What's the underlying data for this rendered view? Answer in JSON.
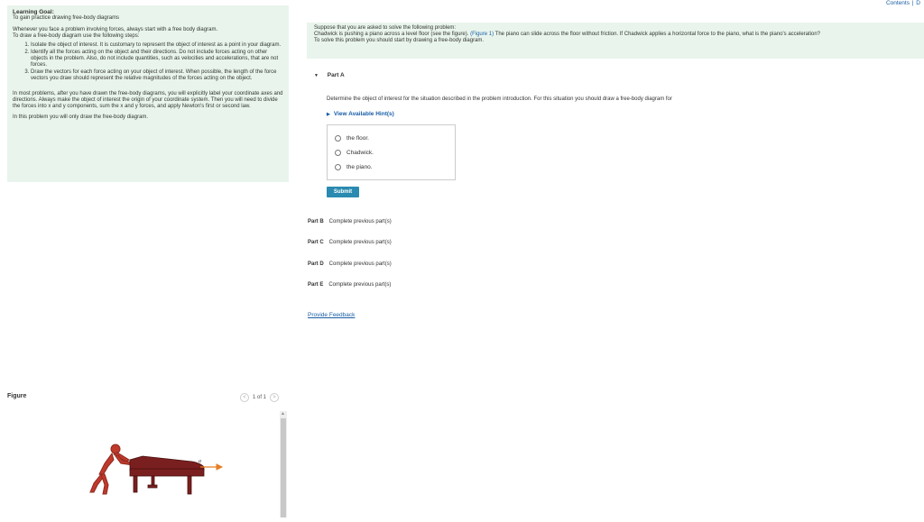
{
  "header": {
    "links": [
      "Contents",
      "|",
      "D"
    ]
  },
  "goal": {
    "title": "Learning Goal:",
    "subtitle": "To gain practice drawing free-body diagrams",
    "intro1": "Whenever you face a problem involving forces, always start with a free body diagram.",
    "intro2": "To draw a free-body diagram use the following steps:",
    "steps": [
      "Isolate the object of interest. It is customary to represent the object of interest as a point in your diagram.",
      "Identify all the forces acting on the object and their directions. Do not include forces acting on other objects in the problem. Also, do not include quantities, such as velocities and accelerations, that are not forces.",
      "Draw the vectors for each force acting on your object of interest. When possible, the length of the force vectors you draw should represent the relative magnitudes of the forces acting on the object."
    ],
    "para1": "In most problems, after you have drawn the free-body diagrams, you will explicitly label your coordinate axes and directions. Always make the object of interest the origin of your coordinate system. Then you will need to divide the forces into x and y components, sum the x and y forces, and apply Newton's first or second law.",
    "para2": "In this problem you will only draw the free-body diagram."
  },
  "figure": {
    "label": "Figure",
    "pager": "1 of 1",
    "prev": "<",
    "next": ">",
    "vector_label": "a"
  },
  "problem": {
    "line1": "Suppose that you are asked to solve the following problem:",
    "line2a": "Chadwick is pushing a piano across a level floor (see the figure). ",
    "figure_link": "(Figure 1)",
    "line2b": " The piano can slide across the floor without friction. If Chadwick applies a horizontal force to the piano, what is the piano's acceleration?",
    "line3": "To solve this problem you should start by drawing a free-body diagram."
  },
  "partA": {
    "label": "Part A",
    "question": "Determine the object of interest for the situation described in the problem introduction. For this situation you should draw a free-body diagram for",
    "hints": "View Available Hint(s)",
    "choices": [
      "the floor.",
      "Chadwick.",
      "the piano."
    ],
    "submit": "Submit"
  },
  "parts": [
    {
      "label": "Part B",
      "status": "Complete previous part(s)"
    },
    {
      "label": "Part C",
      "status": "Complete previous part(s)"
    },
    {
      "label": "Part D",
      "status": "Complete previous part(s)"
    },
    {
      "label": "Part E",
      "status": "Complete previous part(s)"
    }
  ],
  "feedback": "Provide Feedback",
  "colors": {
    "panel": "#e9f5ec",
    "link": "#1a5ea6",
    "submit": "#2a8ab0",
    "figure_person": "#c0392b",
    "figure_piano": "#7a1f1f",
    "figure_arrow": "#e67e22"
  }
}
